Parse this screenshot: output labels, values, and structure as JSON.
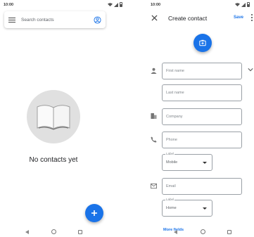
{
  "left_screen": {
    "status_time": "10:00",
    "search_placeholder": "Search contacts",
    "empty_message": "No contacts yet",
    "icons": [
      "menu-icon",
      "account-circle-icon",
      "open-book-icon",
      "plus-icon"
    ]
  },
  "right_screen": {
    "status_time": "10:00",
    "title": "Create contact",
    "save_label": "Save",
    "fields": {
      "first_name": "First name",
      "last_name": "Last name",
      "company": "Company",
      "phone": "Phone",
      "phone_type_label": "Label",
      "phone_type_value": "Mobile",
      "email": "Email",
      "email_type_label": "Label",
      "email_type_value": "Home"
    },
    "more_fields_label": "More fields",
    "colors": {
      "accent": "#1a73e8",
      "border": "#9aa0a6"
    }
  }
}
